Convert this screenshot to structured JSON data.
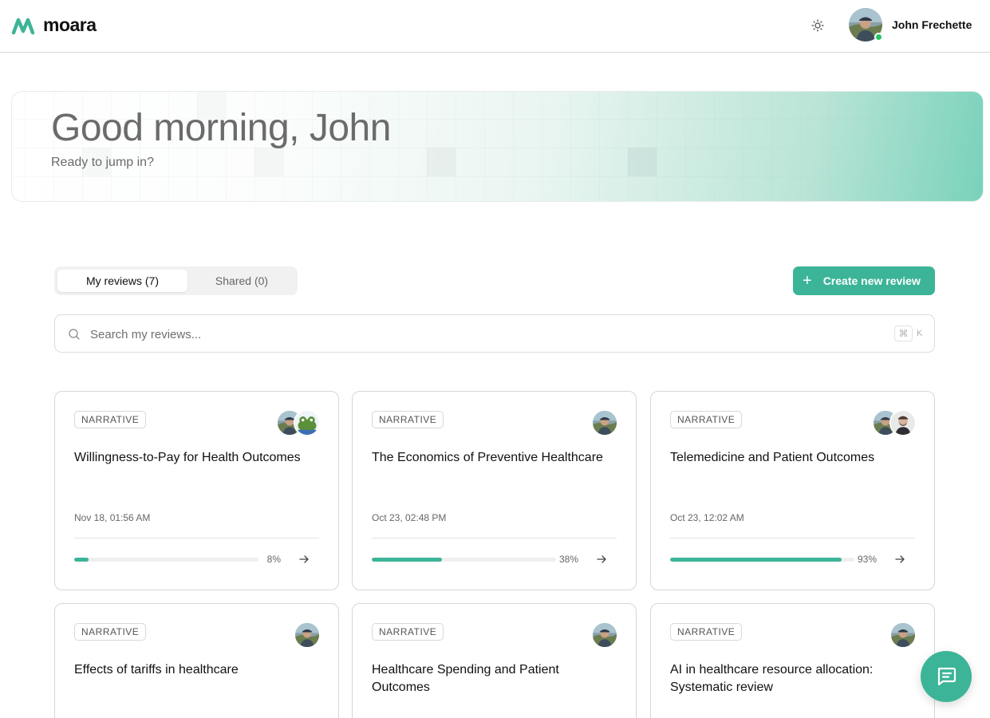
{
  "app": {
    "logo_text": "moara",
    "brand_color": "#3cb497"
  },
  "header": {
    "user_name": "John Frechette",
    "theme_icon": "sun-icon",
    "online_status_color": "#22c55e"
  },
  "hero": {
    "greeting": "Good morning, John",
    "subtitle": "Ready to jump in?"
  },
  "tabs": [
    {
      "label": "My reviews (7)",
      "active": true
    },
    {
      "label": "Shared (0)",
      "active": false
    }
  ],
  "create_button": {
    "label": "Create new review",
    "icon": "plus-icon"
  },
  "search": {
    "placeholder": "Search my reviews...",
    "value": "",
    "shortcut_symbol": "⌘",
    "shortcut_key": "K"
  },
  "reviews": [
    {
      "type": "NARRATIVE",
      "title": "Willingness-to-Pay for Health Outcomes",
      "date": "Nov 18, 01:56 AM",
      "progress": 8,
      "progress_label": "8%",
      "avatars": [
        "user-avatar",
        "frog-avatar"
      ]
    },
    {
      "type": "NARRATIVE",
      "title": "The Economics of Preventive Healthcare",
      "date": "Oct 23, 02:48 PM",
      "progress": 38,
      "progress_label": "38%",
      "avatars": [
        "user-avatar"
      ]
    },
    {
      "type": "NARRATIVE",
      "title": "Telemedicine and Patient Outcomes",
      "date": "Oct 23, 12:02 AM",
      "progress": 93,
      "progress_label": "93%",
      "avatars": [
        "user-avatar",
        "collaborator-avatar"
      ]
    },
    {
      "type": "NARRATIVE",
      "title": "Effects of tariffs in healthcare",
      "avatars": [
        "user-avatar"
      ]
    },
    {
      "type": "NARRATIVE",
      "title": "Healthcare Spending and Patient Outcomes",
      "avatars": [
        "user-avatar"
      ]
    },
    {
      "type": "NARRATIVE",
      "title": "AI in healthcare resource allocation: Systematic review",
      "avatars": [
        "user-avatar"
      ]
    }
  ],
  "chat_button": {
    "icon": "chat-icon"
  }
}
